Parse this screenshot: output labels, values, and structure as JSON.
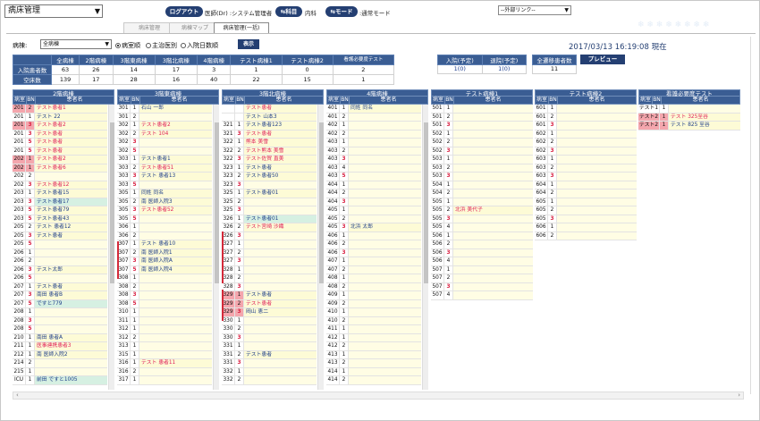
{
  "app": {
    "selector_value": "病床管理"
  },
  "header": {
    "logout_label": "ログアウト",
    "doctor_info": "医師(Dr) :システム管理者",
    "dept_btn": "科目",
    "dept_value": "内科",
    "mode_btn": "モード",
    "mode_value": ":通常モード",
    "external_link": "--外部リンク--"
  },
  "tabs": [
    {
      "label": "病床管理"
    },
    {
      "label": "病棟マップ"
    },
    {
      "label": "病床管理(一括)"
    }
  ],
  "filter": {
    "ward_label": "病棟:",
    "ward_value": "全病棟",
    "radio1": "病室順",
    "radio2": "主治医別",
    "radio3": "入院日数順",
    "display_btn": "表示"
  },
  "datetime": "2017/03/13 16:19:08 現在",
  "summary": {
    "headers": [
      "全病棟",
      "2階病棟",
      "3階東病棟",
      "3階北病棟",
      "4階病棟",
      "テスト病棟1",
      "テスト病棟2",
      "看護必要度テスト"
    ],
    "row1_label": "入院患者数",
    "row1": [
      "63",
      "26",
      "14",
      "17",
      "3",
      "1",
      "0",
      "2"
    ],
    "row2_label": "空床数",
    "row2": [
      "139",
      "17",
      "28",
      "16",
      "40",
      "22",
      "15",
      "1"
    ]
  },
  "stats": {
    "adm_h": "入院(予定)",
    "adm_v": "1(0)",
    "dis_h": "退院(予定)",
    "dis_v": "1(0)",
    "transfer_h": "全遷移患者数",
    "transfer_v": "11",
    "preview_btn": "プレビュー"
  },
  "col_header": {
    "room": "病室",
    "bn": "BN",
    "name": "患者名"
  },
  "wards": [
    {
      "title": "2階病棟",
      "rows": [
        [
          "201",
          "2",
          "テスト患者1",
          "r",
          "p"
        ],
        [
          "201",
          "1",
          "テスト 22",
          "b",
          ""
        ],
        [
          "201",
          "3",
          "テスト患者2",
          "r",
          "p"
        ],
        [
          "201",
          "3",
          "テスト患者",
          "r",
          ""
        ],
        [
          "201",
          "5",
          "テスト患者",
          "r",
          ""
        ],
        [
          "201",
          "5",
          "テスト患者",
          "r",
          ""
        ],
        [
          "202",
          "1",
          "テスト患者2",
          "r",
          "p"
        ],
        [
          "202",
          "1",
          "テスト患者6",
          "r",
          "p"
        ],
        [
          "202",
          "2",
          "",
          "",
          ""
        ],
        [
          "202",
          "3",
          "テスト患者12",
          "r",
          ""
        ],
        [
          "203",
          "1",
          "テスト患者15",
          "b",
          ""
        ],
        [
          "203",
          "3",
          "テスト患者17",
          "b",
          "f"
        ],
        [
          "203",
          "5",
          "テスト患者79",
          "b",
          ""
        ],
        [
          "203",
          "5",
          "テスト患者43",
          "b",
          ""
        ],
        [
          "205",
          "2",
          "テスト 患者12",
          "b",
          ""
        ],
        [
          "205",
          "3",
          "テスト患者",
          "b",
          ""
        ],
        [
          "205",
          "5",
          "",
          "",
          ""
        ],
        [
          "206",
          "1",
          "",
          "",
          ""
        ],
        [
          "206",
          "2",
          "",
          "",
          ""
        ],
        [
          "206",
          "3",
          "テスト太郎",
          "b",
          ""
        ],
        [
          "206",
          "5",
          "",
          "",
          ""
        ],
        [
          "207",
          "1",
          "テスト患者",
          "b",
          ""
        ],
        [
          "207",
          "3",
          "南田 患者B",
          "b",
          ""
        ],
        [
          "207",
          "5",
          "ですと779",
          "b",
          "f"
        ],
        [
          "208",
          "1",
          "",
          "",
          ""
        ],
        [
          "208",
          "3",
          "",
          "",
          ""
        ],
        [
          "208",
          "5",
          "",
          "",
          ""
        ],
        [
          "210",
          "1",
          "南田 患者A",
          "b",
          ""
        ],
        [
          "211",
          "1",
          "医事連携患者3",
          "r",
          ""
        ],
        [
          "212",
          "1",
          "南 医師入院2",
          "b",
          ""
        ],
        [
          "214",
          "2",
          "",
          "",
          ""
        ],
        [
          "215",
          "1",
          "",
          "",
          ""
        ],
        [
          "ICU",
          "1",
          "前田 ですと1005",
          "b",
          "f"
        ]
      ]
    },
    {
      "title": "3階東病棟",
      "rows": [
        [
          "301",
          "1",
          "石山 一郎",
          "b",
          ""
        ],
        [
          "301",
          "2",
          "",
          "",
          ""
        ],
        [
          "302",
          "1",
          "テスト患者2",
          "r",
          ""
        ],
        [
          "302",
          "2",
          "テスト 104",
          "r",
          ""
        ],
        [
          "302",
          "3",
          "",
          "",
          ""
        ],
        [
          "302",
          "5",
          "",
          "",
          ""
        ],
        [
          "303",
          "1",
          "テスト患者1",
          "b",
          ""
        ],
        [
          "303",
          "2",
          "テスト患者51",
          "r",
          ""
        ],
        [
          "303",
          "3",
          "テスト 患者13",
          "b",
          ""
        ],
        [
          "303",
          "5",
          "",
          "",
          ""
        ],
        [
          "305",
          "1",
          "同姓 同名",
          "b",
          ""
        ],
        [
          "305",
          "2",
          "南 医師入院3",
          "b",
          ""
        ],
        [
          "305",
          "3",
          "テスト患者52",
          "r",
          ""
        ],
        [
          "305",
          "5",
          "",
          "",
          ""
        ],
        [
          "306",
          "1",
          "",
          "",
          ""
        ],
        [
          "306",
          "2",
          "",
          "",
          ""
        ],
        [
          "307",
          "1",
          "テスト 患者10",
          "b",
          ""
        ],
        [
          "307",
          "2",
          "南 医師入院1",
          "b",
          ""
        ],
        [
          "307",
          "3",
          "南 医師入院A",
          "b",
          ""
        ],
        [
          "307",
          "5",
          "南 医師入院4",
          "b",
          ""
        ],
        [
          "308",
          "1",
          "",
          "",
          ""
        ],
        [
          "308",
          "2",
          "",
          "",
          ""
        ],
        [
          "308",
          "3",
          "",
          "",
          ""
        ],
        [
          "308",
          "5",
          "",
          "",
          ""
        ],
        [
          "310",
          "1",
          "",
          "",
          ""
        ],
        [
          "311",
          "1",
          "",
          "",
          ""
        ],
        [
          "312",
          "1",
          "",
          "",
          ""
        ],
        [
          "312",
          "2",
          "",
          "",
          ""
        ],
        [
          "313",
          "1",
          "",
          "",
          ""
        ],
        [
          "315",
          "1",
          "",
          "",
          ""
        ],
        [
          "316",
          "1",
          "テスト 患者11",
          "r",
          ""
        ],
        [
          "316",
          "2",
          "",
          "",
          ""
        ],
        [
          "317",
          "1",
          "",
          "",
          ""
        ]
      ]
    },
    {
      "title": "3階北病棟",
      "rows": [
        [
          "",
          "",
          "テスト患者",
          "r",
          ""
        ],
        [
          "",
          "",
          "テスト 山本3",
          "b",
          ""
        ],
        [
          "321",
          "1",
          "テスト患者123",
          "b",
          ""
        ],
        [
          "321",
          "3",
          "テスト患者",
          "r",
          ""
        ],
        [
          "322",
          "1",
          "熊本 美雪",
          "r",
          ""
        ],
        [
          "322",
          "2",
          "テスト熊本 美雪",
          "r",
          ""
        ],
        [
          "322",
          "3",
          "テスト佐賀 直美",
          "r",
          ""
        ],
        [
          "323",
          "1",
          "テスト患者",
          "b",
          ""
        ],
        [
          "323",
          "2",
          "テスト患者50",
          "b",
          ""
        ],
        [
          "323",
          "3",
          "",
          "",
          ""
        ],
        [
          "325",
          "1",
          "テスト患者01",
          "b",
          ""
        ],
        [
          "325",
          "2",
          "",
          "",
          ""
        ],
        [
          "325",
          "3",
          "",
          "",
          ""
        ],
        [
          "326",
          "1",
          "テスト患者01",
          "b",
          "f"
        ],
        [
          "326",
          "2",
          "テスト宮崎 沙織",
          "r",
          ""
        ],
        [
          "326",
          "3",
          "",
          "",
          ""
        ],
        [
          "327",
          "1",
          "",
          "",
          ""
        ],
        [
          "327",
          "2",
          "",
          "",
          ""
        ],
        [
          "327",
          "3",
          "",
          "",
          ""
        ],
        [
          "328",
          "1",
          "",
          "",
          ""
        ],
        [
          "328",
          "2",
          "",
          "",
          ""
        ],
        [
          "328",
          "3",
          "",
          "",
          ""
        ],
        [
          "329",
          "1",
          "テスト患者",
          "b",
          "p"
        ],
        [
          "329",
          "2",
          "テスト患者",
          "r",
          "p"
        ],
        [
          "329",
          "3",
          "岡山 恵二",
          "b",
          "p"
        ],
        [
          "330",
          "1",
          "",
          "",
          ""
        ],
        [
          "330",
          "2",
          "",
          "",
          ""
        ],
        [
          "330",
          "3",
          "",
          "",
          ""
        ],
        [
          "331",
          "1",
          "",
          "",
          ""
        ],
        [
          "331",
          "2",
          "テスト患者",
          "b",
          ""
        ],
        [
          "331",
          "3",
          "",
          "",
          ""
        ],
        [
          "332",
          "1",
          "",
          "",
          ""
        ],
        [
          "332",
          "2",
          "",
          "",
          ""
        ]
      ]
    },
    {
      "title": "4階病棟",
      "rows": [
        [
          "401",
          "1",
          "同姓 同名",
          "b",
          ""
        ],
        [
          "401",
          "2",
          "",
          "",
          ""
        ],
        [
          "402",
          "1",
          "",
          "",
          ""
        ],
        [
          "402",
          "2",
          "",
          "",
          ""
        ],
        [
          "403",
          "1",
          "",
          "",
          ""
        ],
        [
          "403",
          "2",
          "",
          "",
          ""
        ],
        [
          "403",
          "3",
          "",
          "",
          ""
        ],
        [
          "403",
          "4",
          "",
          "",
          ""
        ],
        [
          "403",
          "5",
          "",
          "",
          ""
        ],
        [
          "404",
          "1",
          "",
          "",
          ""
        ],
        [
          "404",
          "2",
          "",
          "",
          ""
        ],
        [
          "404",
          "3",
          "",
          "",
          ""
        ],
        [
          "405",
          "1",
          "",
          "",
          ""
        ],
        [
          "405",
          "2",
          "",
          "",
          ""
        ],
        [
          "405",
          "3",
          "北浜 太郎",
          "b",
          ""
        ],
        [
          "406",
          "1",
          "",
          "",
          ""
        ],
        [
          "406",
          "2",
          "",
          "",
          ""
        ],
        [
          "406",
          "3",
          "",
          "",
          ""
        ],
        [
          "407",
          "1",
          "",
          "",
          ""
        ],
        [
          "407",
          "2",
          "",
          "",
          ""
        ],
        [
          "408",
          "1",
          "",
          "",
          ""
        ],
        [
          "408",
          "2",
          "",
          "",
          ""
        ],
        [
          "409",
          "1",
          "",
          "",
          ""
        ],
        [
          "409",
          "2",
          "",
          "",
          ""
        ],
        [
          "410",
          "1",
          "",
          "",
          ""
        ],
        [
          "410",
          "2",
          "",
          "",
          ""
        ],
        [
          "411",
          "1",
          "",
          "",
          ""
        ],
        [
          "412",
          "1",
          "",
          "",
          ""
        ],
        [
          "412",
          "2",
          "",
          "",
          ""
        ],
        [
          "413",
          "1",
          "",
          "",
          ""
        ],
        [
          "413",
          "2",
          "",
          "",
          ""
        ],
        [
          "414",
          "1",
          "",
          "",
          ""
        ],
        [
          "414",
          "2",
          "",
          "",
          ""
        ]
      ]
    },
    {
      "title": "テスト病棟1",
      "rows": [
        [
          "501",
          "1",
          "",
          "",
          ""
        ],
        [
          "501",
          "2",
          "",
          "",
          ""
        ],
        [
          "501",
          "3",
          "",
          "",
          ""
        ],
        [
          "502",
          "1",
          "",
          "",
          ""
        ],
        [
          "502",
          "2",
          "",
          "",
          ""
        ],
        [
          "502",
          "3",
          "",
          "",
          ""
        ],
        [
          "503",
          "1",
          "",
          "",
          ""
        ],
        [
          "503",
          "2",
          "",
          "",
          ""
        ],
        [
          "503",
          "3",
          "",
          "",
          ""
        ],
        [
          "504",
          "1",
          "",
          "",
          ""
        ],
        [
          "504",
          "2",
          "",
          "",
          ""
        ],
        [
          "505",
          "1",
          "",
          "",
          ""
        ],
        [
          "505",
          "2",
          "北浜 美代子",
          "r",
          ""
        ],
        [
          "505",
          "3",
          "",
          "",
          ""
        ],
        [
          "505",
          "4",
          "",
          "",
          ""
        ],
        [
          "506",
          "1",
          "",
          "",
          ""
        ],
        [
          "506",
          "2",
          "",
          "",
          ""
        ],
        [
          "506",
          "3",
          "",
          "",
          ""
        ],
        [
          "506",
          "4",
          "",
          "",
          ""
        ],
        [
          "507",
          "1",
          "",
          "",
          ""
        ],
        [
          "507",
          "2",
          "",
          "",
          ""
        ],
        [
          "507",
          "3",
          "",
          "",
          ""
        ],
        [
          "507",
          "4",
          "",
          "",
          ""
        ]
      ]
    },
    {
      "title": "テスト病棟2",
      "rows": [
        [
          "601",
          "1",
          "",
          "",
          ""
        ],
        [
          "601",
          "2",
          "",
          "",
          ""
        ],
        [
          "601",
          "3",
          "",
          "",
          ""
        ],
        [
          "602",
          "1",
          "",
          "",
          ""
        ],
        [
          "602",
          "2",
          "",
          "",
          ""
        ],
        [
          "602",
          "3",
          "",
          "",
          ""
        ],
        [
          "603",
          "1",
          "",
          "",
          ""
        ],
        [
          "603",
          "2",
          "",
          "",
          ""
        ],
        [
          "603",
          "3",
          "",
          "",
          ""
        ],
        [
          "604",
          "1",
          "",
          "",
          ""
        ],
        [
          "604",
          "2",
          "",
          "",
          ""
        ],
        [
          "605",
          "1",
          "",
          "",
          ""
        ],
        [
          "605",
          "2",
          "",
          "",
          ""
        ],
        [
          "605",
          "3",
          "",
          "",
          ""
        ],
        [
          "606",
          "1",
          "",
          "",
          ""
        ],
        [
          "606",
          "2",
          "",
          "",
          ""
        ]
      ]
    },
    {
      "title": "看護必要度テスト",
      "rows": [
        [
          "テスト1",
          "1",
          "",
          "",
          ""
        ],
        [
          "テスト2",
          "1",
          "テスト 325至谷",
          "r",
          "p"
        ],
        [
          "テスト2",
          "1",
          "テスト 825 至谷",
          "b",
          "p"
        ]
      ]
    }
  ]
}
